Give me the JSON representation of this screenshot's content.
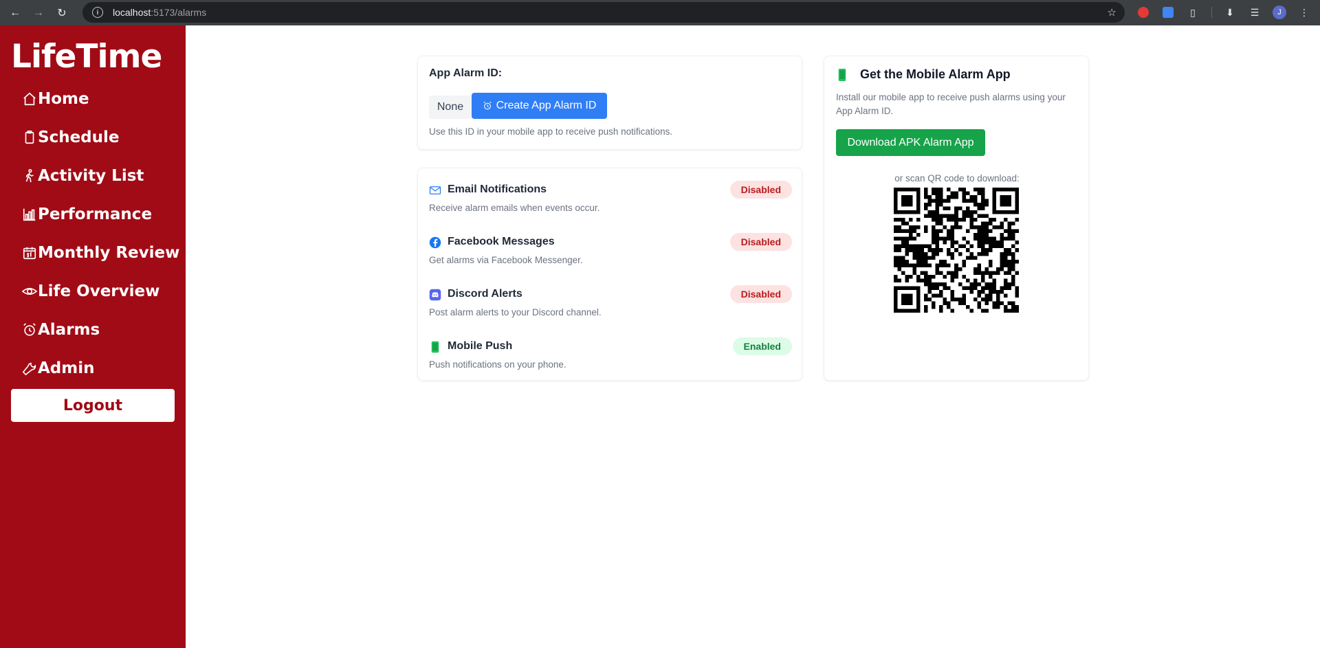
{
  "browser": {
    "url_host": "localhost",
    "url_path": ":5173/alarms",
    "avatar_initial": "J"
  },
  "sidebar": {
    "brand": "LifeTime",
    "items": [
      {
        "label": "Home",
        "icon": "home-icon"
      },
      {
        "label": "Schedule",
        "icon": "clipboard-icon"
      },
      {
        "label": "Activity List",
        "icon": "walking-icon"
      },
      {
        "label": "Performance",
        "icon": "bar-chart-icon"
      },
      {
        "label": "Monthly Review",
        "icon": "calendar-icon"
      },
      {
        "label": "Life Overview",
        "icon": "eye-icon"
      },
      {
        "label": "Alarms",
        "icon": "alarm-clock-icon"
      },
      {
        "label": "Admin",
        "icon": "wrench-icon"
      }
    ],
    "logout": "Logout",
    "bg_color": "#a10b16"
  },
  "app_id": {
    "label": "App Alarm ID:",
    "value": "None",
    "create_button": "Create App Alarm ID",
    "hint": "Use this ID in your mobile app to receive push notifications."
  },
  "notifications": [
    {
      "title": "Email Notifications",
      "description": "Receive alarm emails when events occur.",
      "status": "Disabled",
      "icon": "mail-icon"
    },
    {
      "title": "Facebook Messages",
      "description": "Get alarms via Facebook Messenger.",
      "status": "Disabled",
      "icon": "facebook-icon"
    },
    {
      "title": "Discord Alerts",
      "description": "Post alarm alerts to your Discord channel.",
      "status": "Disabled",
      "icon": "discord-icon"
    },
    {
      "title": "Mobile Push",
      "description": "Push notifications on your phone.",
      "status": "Enabled",
      "icon": "phone-icon"
    }
  ],
  "mobile_app": {
    "title": "Get the Mobile Alarm App",
    "description": "Install our mobile app to receive push alarms using your App Alarm ID.",
    "download_button": "Download APK Alarm App",
    "qr_label": "or scan QR code to download:"
  },
  "colors": {
    "primary_blue": "#2f7ef6",
    "success_green": "#16a34a",
    "disabled_badge_bg": "#fde2e2",
    "enabled_badge_bg": "#dcfce7"
  }
}
